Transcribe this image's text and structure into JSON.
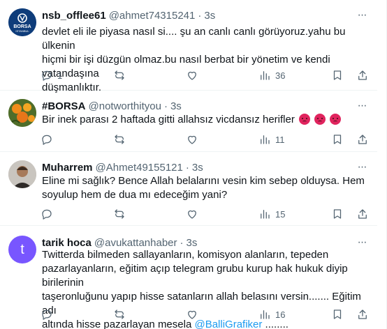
{
  "tweets": [
    {
      "name": "nsb_offlee61",
      "handle": "@ahmet74315241",
      "time": "3s",
      "lines": [
        "devlet eli ile piyasa nasıl si.... şu an canlı canlı görüyoruz.yahu bu ülkenin",
        "hiçmi bir işi düzgün olmaz.bu nasıl berbat bir yönetim ve kendi vatandaşına",
        "düşmanlıktır."
      ],
      "replies": "1",
      "reposts": "",
      "likes": "",
      "views": "36",
      "avatar_text": "BORSA",
      "avatar_subtext": "ISTANBUL"
    },
    {
      "name": "#BORSA",
      "handle": "@notworthityou",
      "time": "3s",
      "text": "Bir inek parası 2 haftada gitti allahsız vicdansız herifler",
      "emoji": [
        "angry-face-emoji",
        "angry-face-emoji",
        "angry-face-emoji"
      ],
      "replies": "",
      "reposts": "",
      "likes": "",
      "views": "11"
    },
    {
      "name": "Muharrem",
      "handle": "@Ahmet49155121",
      "time": "3s",
      "lines": [
        "Eline mi sağlık? Bence Allah belalarını vesin kim sebep olduysa. Hem",
        "soyulup hem de dua mı edeceğim yani?"
      ],
      "replies": "",
      "reposts": "",
      "likes": "",
      "views": "15"
    },
    {
      "name": "tarik hoca",
      "handle": "@avukattanhaber",
      "time": "3s",
      "avatar_letter": "t",
      "lines": [
        "Twitterda bilmeden sallayanların, komisyon alanların, tepeden",
        "pazarlayanların, eğitim açıp telegram grubu kurup hak hukuk diyip birilerinin",
        "taşeronluğunu yapıp hisse satanların allah belasını versin....... Eğitim adı"
      ],
      "last_line_before": "altında hisse pazarlayan mesela ",
      "mention": "@BalliGrafiker",
      "last_line_after": " ........",
      "replies": "",
      "reposts": "",
      "likes": "",
      "views": "16"
    }
  ],
  "more_label": "···",
  "dot": "·",
  "colors": {
    "text": "#0f1419",
    "secondary": "#536471",
    "link": "#1d9bf0",
    "border": "#eff3f4",
    "avatar_borsa": "#0e3c7a",
    "avatar_tarik": "#7856ff"
  },
  "icons": [
    "reply-icon",
    "repost-icon",
    "like-icon",
    "views-icon",
    "bookmark-icon",
    "share-icon",
    "more-icon"
  ]
}
